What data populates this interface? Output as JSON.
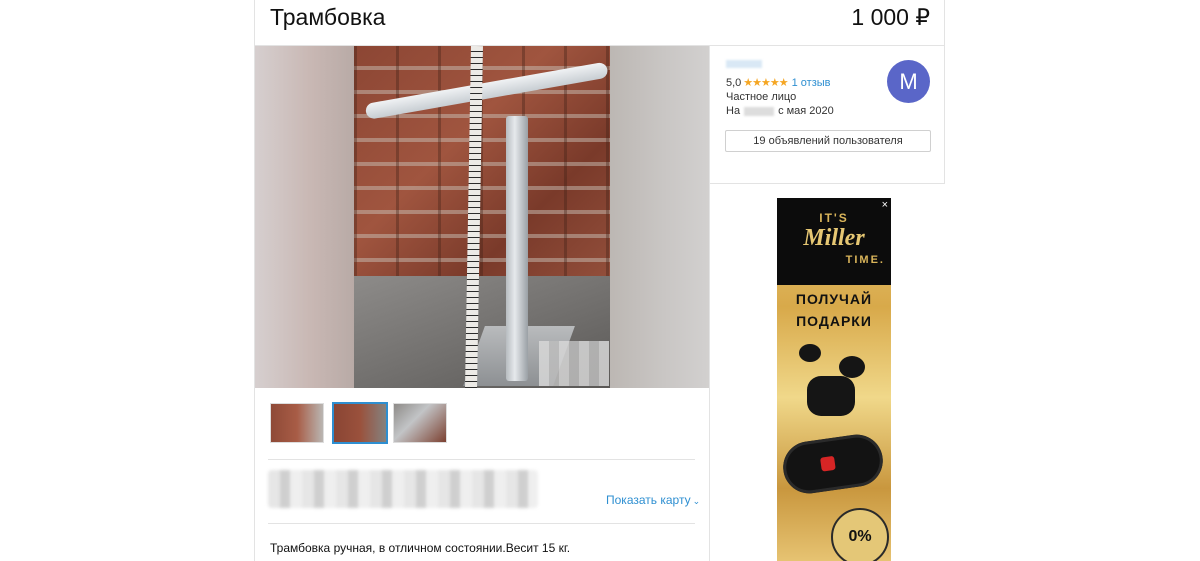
{
  "listing": {
    "title": "Трамбовка",
    "price": "1 000 ₽",
    "show_map_label": "Показать карту",
    "description": "Трамбовка ручная, в отличном состоянии.Весит 15 кг."
  },
  "seller": {
    "rating": "5,0",
    "stars": "★★★★★",
    "reviews": "1 отзыв",
    "type": "Частное лицо",
    "since_prefix": "На",
    "since_suffix": "с мая 2020",
    "avatar_letter": "M",
    "ads_button_label": "19 объявлений пользователя"
  },
  "ad": {
    "close": "×",
    "brand_top": "IT'S",
    "brand_name": "Miller",
    "brand_bottom": "TIME.",
    "headline_1": "ПОЛУЧАЙ",
    "headline_2": "ПОДАРКИ",
    "badge": "0%"
  },
  "colors": {
    "link": "#2e8fd1",
    "avatar": "#5a66c8",
    "stars": "#f5a623"
  }
}
